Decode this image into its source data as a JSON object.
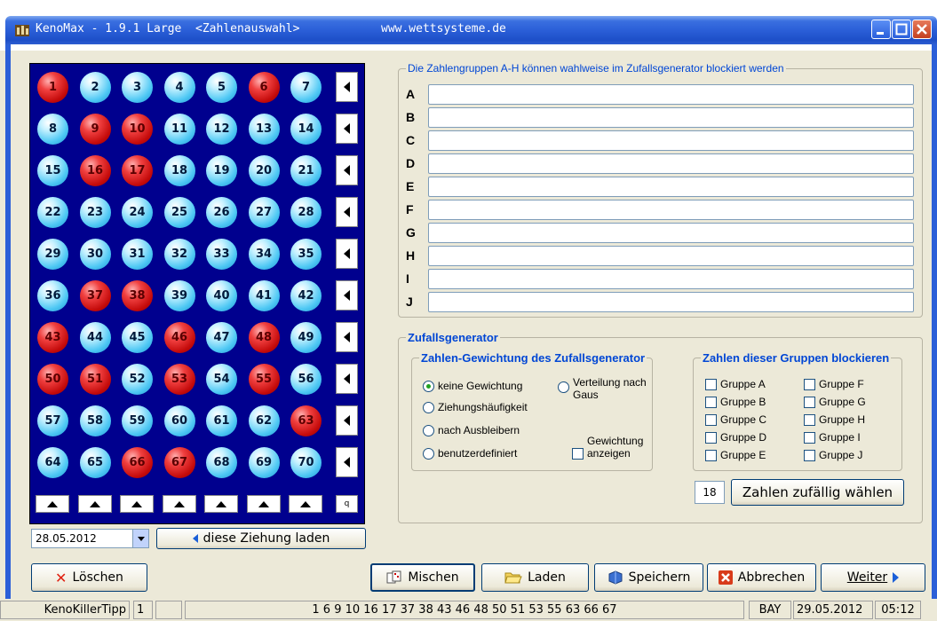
{
  "window": {
    "title": "KenoMax - 1.9.1 Large  <Zahlenauswahl>",
    "url": "www.wettsysteme.de"
  },
  "board": {
    "rows": [
      [
        {
          "n": "1",
          "red": true
        },
        {
          "n": "2",
          "red": false
        },
        {
          "n": "3",
          "red": false
        },
        {
          "n": "4",
          "red": false
        },
        {
          "n": "5",
          "red": false
        },
        {
          "n": "6",
          "red": true
        },
        {
          "n": "7",
          "red": false
        }
      ],
      [
        {
          "n": "8",
          "red": false
        },
        {
          "n": "9",
          "red": true
        },
        {
          "n": "10",
          "red": true
        },
        {
          "n": "11",
          "red": false
        },
        {
          "n": "12",
          "red": false
        },
        {
          "n": "13",
          "red": false
        },
        {
          "n": "14",
          "red": false
        }
      ],
      [
        {
          "n": "15",
          "red": false
        },
        {
          "n": "16",
          "red": true
        },
        {
          "n": "17",
          "red": true
        },
        {
          "n": "18",
          "red": false
        },
        {
          "n": "19",
          "red": false
        },
        {
          "n": "20",
          "red": false
        },
        {
          "n": "21",
          "red": false
        }
      ],
      [
        {
          "n": "22",
          "red": false
        },
        {
          "n": "23",
          "red": false
        },
        {
          "n": "24",
          "red": false
        },
        {
          "n": "25",
          "red": false
        },
        {
          "n": "26",
          "red": false
        },
        {
          "n": "27",
          "red": false
        },
        {
          "n": "28",
          "red": false
        }
      ],
      [
        {
          "n": "29",
          "red": false
        },
        {
          "n": "30",
          "red": false
        },
        {
          "n": "31",
          "red": false
        },
        {
          "n": "32",
          "red": false
        },
        {
          "n": "33",
          "red": false
        },
        {
          "n": "34",
          "red": false
        },
        {
          "n": "35",
          "red": false
        }
      ],
      [
        {
          "n": "36",
          "red": false
        },
        {
          "n": "37",
          "red": true
        },
        {
          "n": "38",
          "red": true
        },
        {
          "n": "39",
          "red": false
        },
        {
          "n": "40",
          "red": false
        },
        {
          "n": "41",
          "red": false
        },
        {
          "n": "42",
          "red": false
        }
      ],
      [
        {
          "n": "43",
          "red": true
        },
        {
          "n": "44",
          "red": false
        },
        {
          "n": "45",
          "red": false
        },
        {
          "n": "46",
          "red": true
        },
        {
          "n": "47",
          "red": false
        },
        {
          "n": "48",
          "red": true
        },
        {
          "n": "49",
          "red": false
        }
      ],
      [
        {
          "n": "50",
          "red": true
        },
        {
          "n": "51",
          "red": true
        },
        {
          "n": "52",
          "red": false
        },
        {
          "n": "53",
          "red": true
        },
        {
          "n": "54",
          "red": false
        },
        {
          "n": "55",
          "red": true
        },
        {
          "n": "56",
          "red": false
        }
      ],
      [
        {
          "n": "57",
          "red": false
        },
        {
          "n": "58",
          "red": false
        },
        {
          "n": "59",
          "red": false
        },
        {
          "n": "60",
          "red": false
        },
        {
          "n": "61",
          "red": false
        },
        {
          "n": "62",
          "red": false
        },
        {
          "n": "63",
          "red": true
        }
      ],
      [
        {
          "n": "64",
          "red": false
        },
        {
          "n": "65",
          "red": false
        },
        {
          "n": "66",
          "red": true
        },
        {
          "n": "67",
          "red": true
        },
        {
          "n": "68",
          "red": false
        },
        {
          "n": "69",
          "red": false
        },
        {
          "n": "70",
          "red": false
        }
      ]
    ],
    "corner_label": "q",
    "colors": {
      "board_bg": "#00008e",
      "ball_blue": "#4ec8f4",
      "ball_red": "#c40a0a"
    }
  },
  "date_picker": {
    "value": "28.05.2012"
  },
  "load_draw_button": "diese Ziehung laden",
  "groups": {
    "legend": "Die Zahlengruppen A-H können wahlweise im Zufallsgenerator blockiert werden",
    "letters": [
      "A",
      "B",
      "C",
      "D",
      "E",
      "F",
      "G",
      "H",
      "I",
      "J"
    ]
  },
  "random": {
    "legend": "Zufallsgenerator",
    "weight_legend": "Zahlen-Gewichtung des Zufallsgenerator",
    "options": {
      "none": "keine Gewichtung",
      "frequency": "Ziehungshäufigkeit",
      "absence": "nach Ausbleibern",
      "custom": "benutzerdefiniert",
      "gauss_1": "Verteilung nach",
      "gauss_2": "Gaus"
    },
    "show_weight_1": "Gewichtung",
    "show_weight_2": "anzeigen",
    "block_legend": "Zahlen dieser Gruppen blockieren",
    "block_groups": [
      "Gruppe A",
      "Gruppe B",
      "Gruppe C",
      "Gruppe D",
      "Gruppe E",
      "Gruppe F",
      "Gruppe G",
      "Gruppe H",
      "Gruppe I",
      "Gruppe J"
    ],
    "count": "18",
    "pick_button": "Zahlen zufällig wählen"
  },
  "buttons": {
    "clear": "Löschen",
    "mix": "Mischen",
    "load": "Laden",
    "save": "Speichern",
    "cancel": "Abbrechen",
    "next": "Weiter"
  },
  "status": {
    "app": "KenoKillerTipp",
    "index": "1",
    "numbers": "1 6 9 10 16 17 37 38 43 46 48 50 51 53 55 63 66 67",
    "region": "BAY",
    "date": "29.05.2012",
    "time": "05:12"
  }
}
